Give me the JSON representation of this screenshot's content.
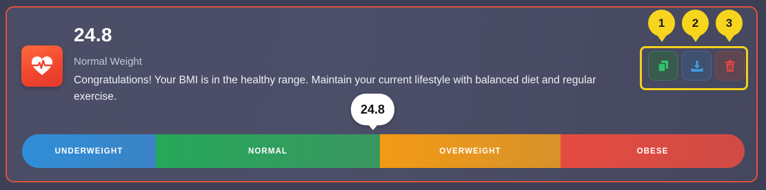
{
  "result": {
    "bmi": "24.8",
    "category": "Normal Weight",
    "message": "Congratulations! Your BMI is in the healthy range. Maintain your current lifestyle with balanced diet and regular exercise."
  },
  "actions": {
    "badges": [
      "1",
      "2",
      "3"
    ],
    "buttons": [
      {
        "name": "copy",
        "icon": "copy-icon",
        "color": "#27c26a"
      },
      {
        "name": "download",
        "icon": "download-icon",
        "color": "#3c9ce0"
      },
      {
        "name": "delete",
        "icon": "trash-icon",
        "color": "#e0443c"
      }
    ]
  },
  "scale": {
    "marker_value": "24.8",
    "segments": [
      {
        "label": "UNDERWEIGHT",
        "color": "#3a8fd6"
      },
      {
        "label": "NORMAL",
        "color": "#2ea35e"
      },
      {
        "label": "OVERWEIGHT",
        "color": "#ef9a1c"
      },
      {
        "label": "OBESE",
        "color": "#e04c42"
      }
    ]
  },
  "colors": {
    "card_border": "#e0513f",
    "highlight": "#f5d11a",
    "icon_bg": "#f0452e"
  }
}
